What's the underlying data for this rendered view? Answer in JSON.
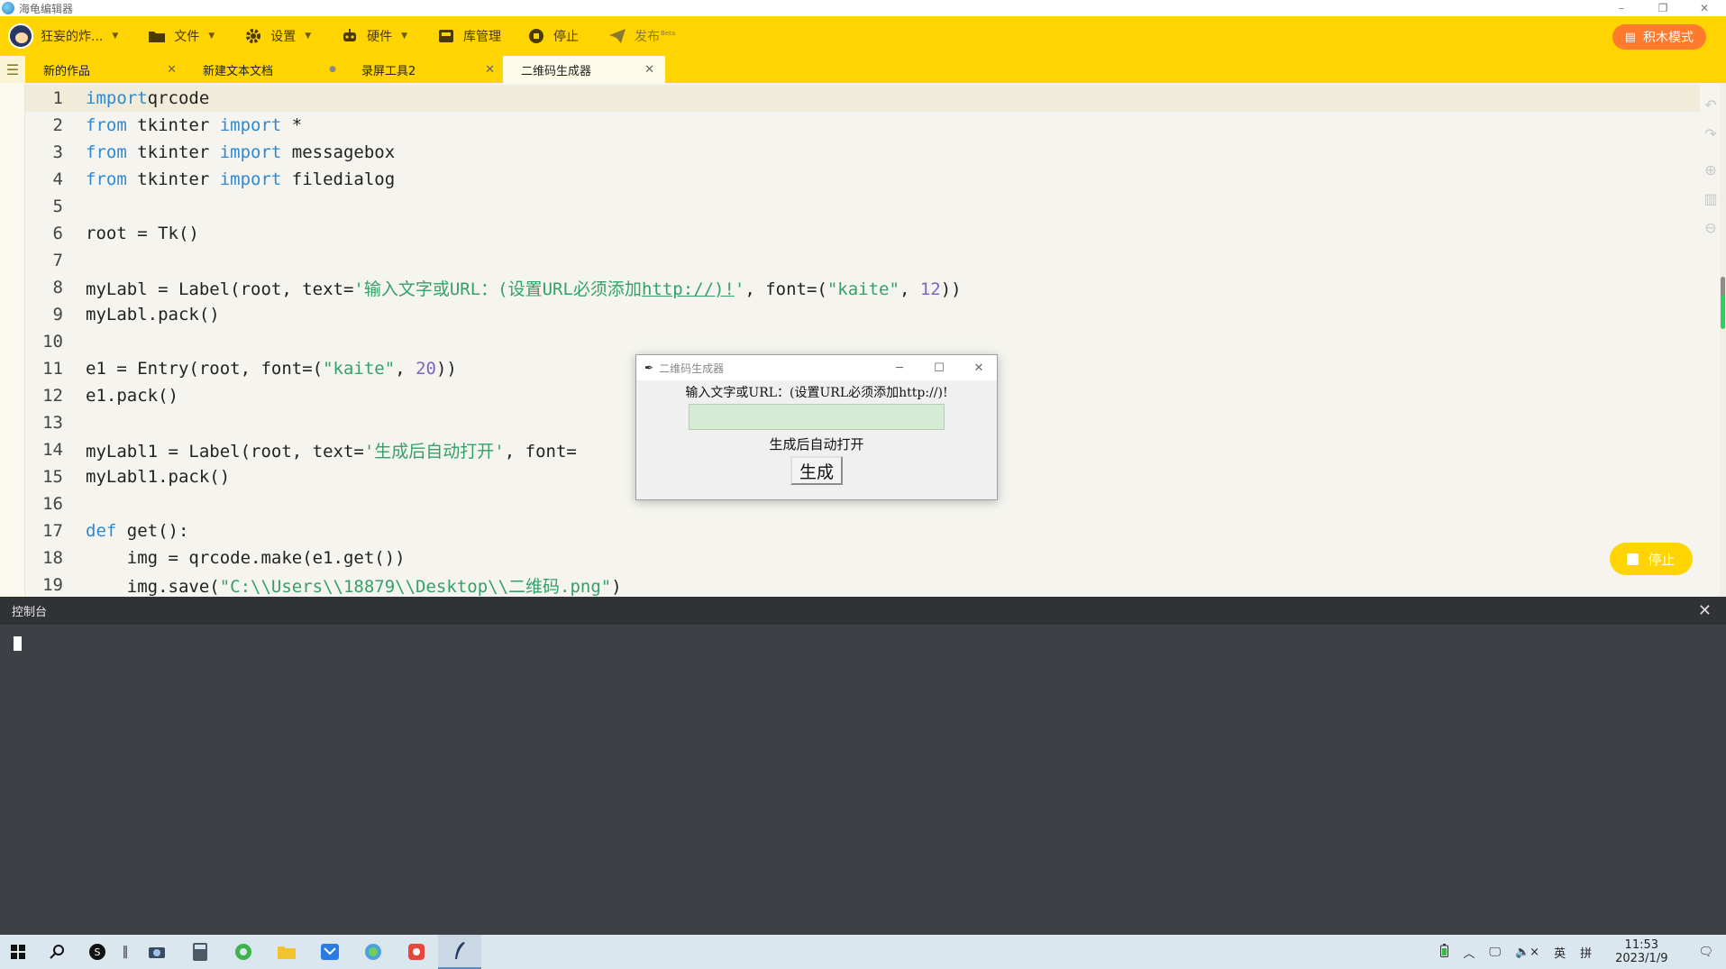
{
  "window": {
    "title": "海龟编辑器",
    "controls": [
      "–",
      "❐",
      "✕"
    ]
  },
  "toolbar": {
    "user_name": "狂妄的炸...",
    "file": "文件",
    "settings": "设置",
    "hardware": "硬件",
    "library": "库管理",
    "stop": "停止",
    "publish": "发布",
    "publish_badge": "Beta",
    "block_mode": "积木模式"
  },
  "tabs": [
    {
      "label": "新的作品",
      "close": "✕"
    },
    {
      "label": "新建文本文档",
      "close": "●"
    },
    {
      "label": "录屏工具2",
      "close": "✕"
    },
    {
      "label": "二维码生成器",
      "close": "✕"
    }
  ],
  "code_lines": [
    {
      "n": "1",
      "parts": [
        [
          "kw",
          "import"
        ],
        [
          "",
          "qrcode"
        ]
      ]
    },
    {
      "n": "2",
      "parts": [
        [
          "kw",
          "from"
        ],
        [
          "",
          " tkinter "
        ],
        [
          "kw",
          "import"
        ],
        [
          "",
          " *"
        ]
      ]
    },
    {
      "n": "3",
      "parts": [
        [
          "kw",
          "from"
        ],
        [
          "",
          " tkinter "
        ],
        [
          "kw",
          "import"
        ],
        [
          "",
          " messagebox"
        ]
      ]
    },
    {
      "n": "4",
      "parts": [
        [
          "kw",
          "from"
        ],
        [
          "",
          " tkinter "
        ],
        [
          "kw",
          "import"
        ],
        [
          "",
          " filedialog"
        ]
      ]
    },
    {
      "n": "5",
      "parts": []
    },
    {
      "n": "6",
      "parts": [
        [
          "",
          "root = Tk()"
        ]
      ]
    },
    {
      "n": "7",
      "parts": []
    },
    {
      "n": "8",
      "parts": [
        [
          "",
          "myLabl = Label(root, text="
        ],
        [
          "str",
          "'输入文字或URL：(设置URL必须添加"
        ],
        [
          "str u",
          "http://)!"
        ],
        [
          "str",
          "'"
        ],
        [
          "",
          ", font=("
        ],
        [
          "str",
          "\"kaite\""
        ],
        [
          "",
          ", "
        ],
        [
          "num",
          "12"
        ],
        [
          "",
          "))"
        ]
      ]
    },
    {
      "n": "9",
      "parts": [
        [
          "",
          "myLabl.pack()"
        ]
      ]
    },
    {
      "n": "10",
      "parts": []
    },
    {
      "n": "11",
      "parts": [
        [
          "",
          "e1 = Entry(root, font=("
        ],
        [
          "str",
          "\"kaite\""
        ],
        [
          "",
          ", "
        ],
        [
          "num",
          "20"
        ],
        [
          "",
          "))"
        ]
      ]
    },
    {
      "n": "12",
      "parts": [
        [
          "",
          "e1.pack()"
        ]
      ]
    },
    {
      "n": "13",
      "parts": []
    },
    {
      "n": "14",
      "parts": [
        [
          "",
          "myLabl1 = Label(root, text="
        ],
        [
          "str",
          "'生成后自动打开'"
        ],
        [
          "",
          ", font="
        ]
      ]
    },
    {
      "n": "15",
      "parts": [
        [
          "",
          "myLabl1.pack()"
        ]
      ]
    },
    {
      "n": "16",
      "parts": []
    },
    {
      "n": "17",
      "parts": [
        [
          "kw",
          "def"
        ],
        [
          "",
          " get():"
        ]
      ]
    },
    {
      "n": "18",
      "parts": [
        [
          "",
          "    img = qrcode.make(e1.get())"
        ]
      ]
    },
    {
      "n": "19",
      "parts": [
        [
          "",
          "    img.save("
        ],
        [
          "str",
          "\"C:\\\\Users\\\\18879\\\\Desktop\\\\二维码.png\""
        ],
        [
          "",
          ")"
        ]
      ]
    }
  ],
  "floating_stop": "停止",
  "tk_window": {
    "title": "二维码生成器",
    "label": "输入文字或URL：(设置URL必须添加http://)!",
    "entry_value": "",
    "label2": "生成后自动打开",
    "button": "生成"
  },
  "console": {
    "title": "控制台",
    "close": "✕"
  },
  "taskbar": {
    "tray": {
      "input_lang": "英",
      "ime": "拼",
      "time": "11:53",
      "date": "2023/1/9"
    }
  },
  "colors": {
    "accent": "#ffd400",
    "block_mode": "#ff7a2d",
    "keyword": "#2f8ad4",
    "string": "#35a06a",
    "number": "#7a67c4"
  }
}
